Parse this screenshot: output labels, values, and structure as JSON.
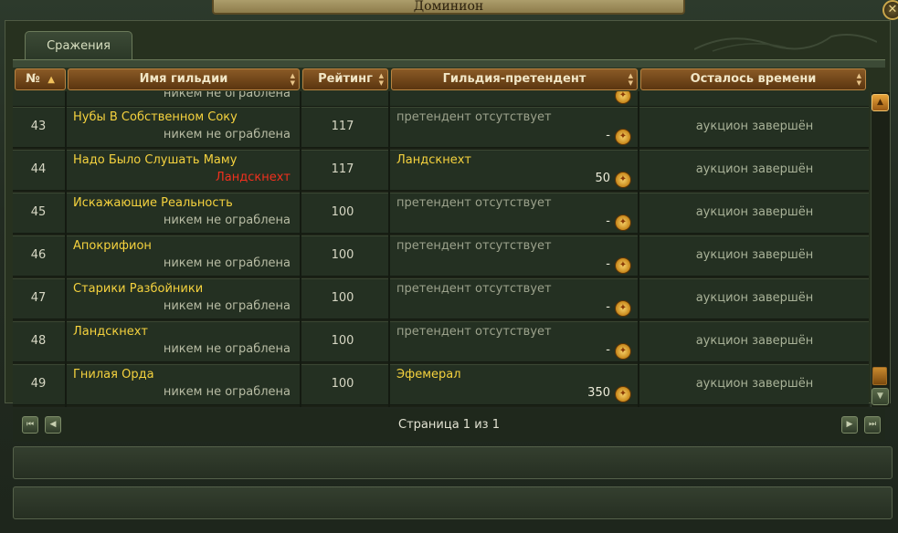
{
  "window": {
    "title": "Доминион"
  },
  "tabs": [
    {
      "label": "Сражения"
    }
  ],
  "columns": {
    "num": "№",
    "guild_name": "Имя гильдии",
    "rating": "Рейтинг",
    "claimant": "Гильдия-претендент",
    "time_left": "Осталось времени"
  },
  "partial_row": {
    "sub": "никем не ограблена"
  },
  "rows": [
    {
      "num": "43",
      "name": "Нубы В Собственном Соку",
      "sub": "никем не ограблена",
      "rating": "117",
      "claimant": "претендент отсутствует",
      "bid": "-",
      "time": "аукцион завершён"
    },
    {
      "num": "44",
      "name": "Надо Было Слушать Маму",
      "sub": "Ландскнехт",
      "rating": "117",
      "claimant": "Ландскнехт",
      "bid": "50",
      "time": "аукцион завершён"
    },
    {
      "num": "45",
      "name": "Искажающие Реальность",
      "sub": "никем не ограблена",
      "rating": "100",
      "claimant": "претендент отсутствует",
      "bid": "-",
      "time": "аукцион завершён"
    },
    {
      "num": "46",
      "name": "Апокрифион",
      "sub": "никем не ограблена",
      "rating": "100",
      "claimant": "претендент отсутствует",
      "bid": "-",
      "time": "аукцион завершён"
    },
    {
      "num": "47",
      "name": "Старики Разбойники",
      "sub": "никем не ограблена",
      "rating": "100",
      "claimant": "претендент отсутствует",
      "bid": "-",
      "time": "аукцион завершён"
    },
    {
      "num": "48",
      "name": "Ландскнехт",
      "sub": "никем не ограблена",
      "rating": "100",
      "claimant": "претендент отсутствует",
      "bid": "-",
      "time": "аукцион завершён"
    },
    {
      "num": "49",
      "name": "Гнилая Орда",
      "sub": "никем не ограблена",
      "rating": "100",
      "claimant": "Эфемерал",
      "bid": "350",
      "time": "аукцион завершён"
    }
  ],
  "pager": {
    "text": "Страница 1 из 1"
  },
  "icons": {
    "coin": "gold-coin-icon",
    "sort": "sort-up-arrow-icon"
  },
  "colors": {
    "guild_name": "#f5d23e",
    "robbed_by": "#f0301e",
    "header": "#8a5a26"
  }
}
